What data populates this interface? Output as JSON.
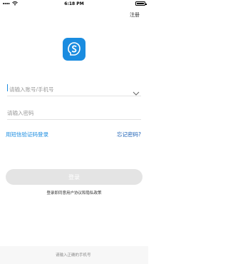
{
  "status_bar": {
    "time": "6:18 PM"
  },
  "header": {
    "register_label": "注册"
  },
  "form": {
    "account_placeholder": "请输入账号/手机号",
    "password_placeholder": "请输入密码"
  },
  "links": {
    "sms_login": "用短信验证码登录",
    "forgot_password": "忘记密码?"
  },
  "login_button": {
    "label": "登录"
  },
  "agreement_text": "登录即同意用户协议和隐私政策",
  "footer": {
    "hint": "请输入正确的手机号"
  },
  "colors": {
    "accent": "#1a8ce0",
    "button_disabled": "#e4e4e4"
  },
  "icons": {
    "logo": "app-logo-icon",
    "chevron": "chevron-down-icon",
    "wifi": "wifi-icon",
    "battery": "battery-icon"
  }
}
